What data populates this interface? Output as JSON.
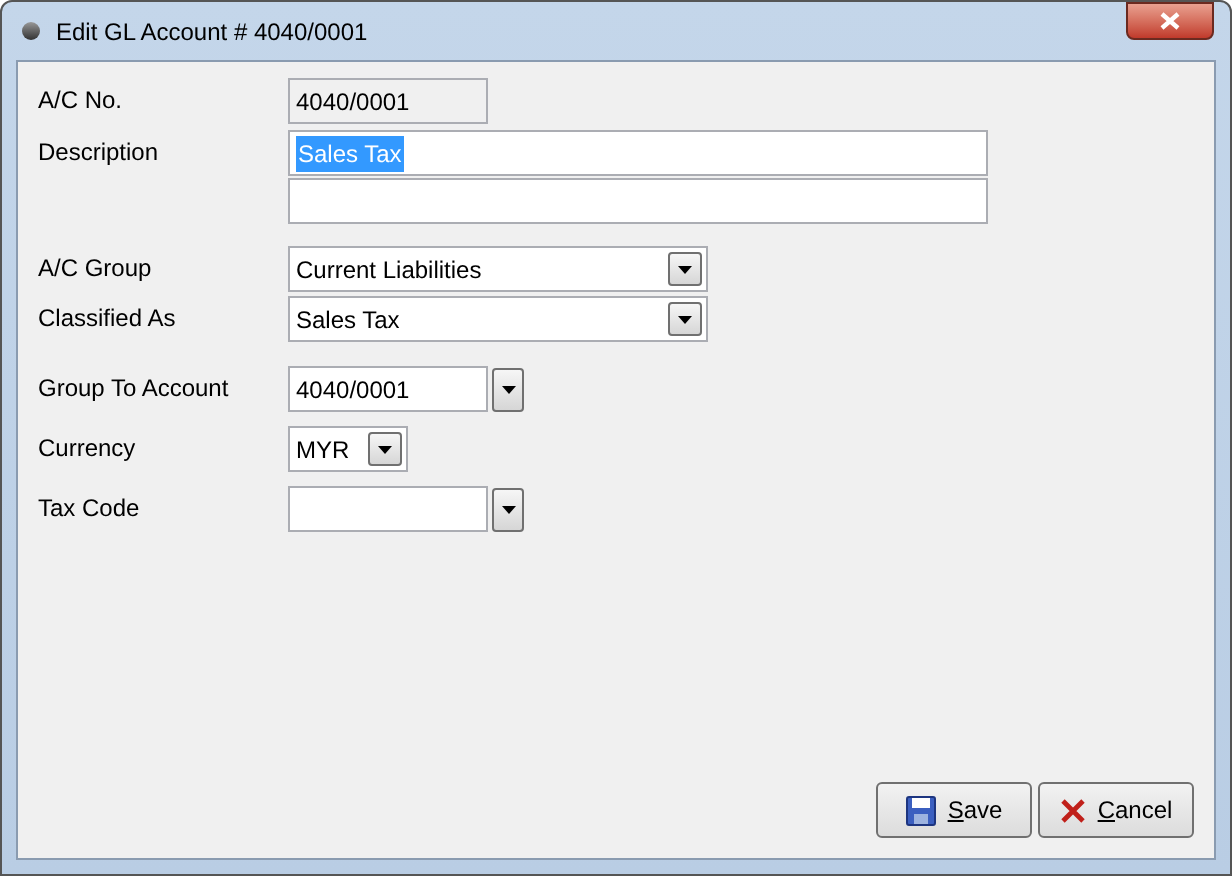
{
  "window": {
    "title": "Edit GL Account # 4040/0001"
  },
  "fields": [
    {
      "label": "A/C No.",
      "kind": "text",
      "value": "4040/0001",
      "disabled": true
    },
    {
      "label": "Description",
      "kind": "multiline",
      "value": "Sales Tax",
      "highlighted": true
    },
    {
      "label": "A/C Group",
      "kind": "combo",
      "value": "Current Liabilities"
    },
    {
      "label": "Classified As",
      "kind": "combo",
      "value": "Sales Tax"
    },
    {
      "label": "Group To Account",
      "kind": "lookup",
      "value": "4040/0001"
    },
    {
      "label": "Currency",
      "kind": "small-combo",
      "value": "MYR"
    },
    {
      "label": "Tax Code",
      "kind": "lookup"
    }
  ],
  "buttons": [
    {
      "label": "Save",
      "kind": "save"
    },
    {
      "label": "Cancel",
      "kind": "cancel"
    }
  ]
}
